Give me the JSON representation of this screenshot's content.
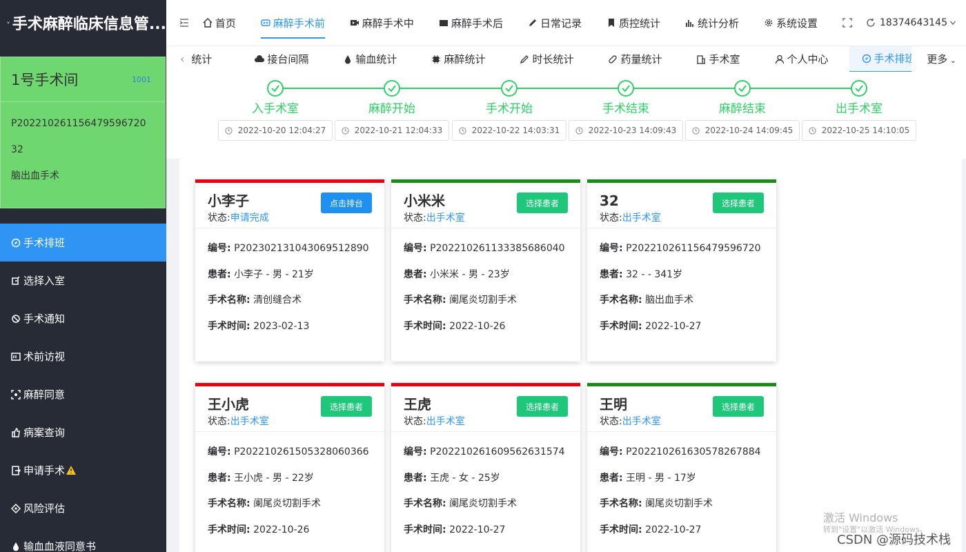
{
  "app": {
    "title": "手术麻醉临床信息管..."
  },
  "room": {
    "name": "1号手术间",
    "code": "1001",
    "patient_id": "P202210261156479596720",
    "patient_name": "32",
    "operation": "脑出血手术"
  },
  "sidebar": {
    "items": [
      {
        "label": "手术排班",
        "icon": "compass-icon"
      },
      {
        "label": "选择入室",
        "icon": "door-icon"
      },
      {
        "label": "手术通知",
        "icon": "bell-off-icon"
      },
      {
        "label": "术前访视",
        "icon": "id-card-icon"
      },
      {
        "label": "麻醉同意",
        "icon": "scan-icon"
      },
      {
        "label": "病案查询",
        "icon": "thumb-icon"
      },
      {
        "label": "申请手术",
        "icon": "export-icon"
      },
      {
        "label": "风险评估",
        "icon": "diamond-icon"
      },
      {
        "label": "输血血液同意书",
        "icon": "drop-icon"
      }
    ]
  },
  "top_nav": {
    "items": [
      {
        "label": "首页",
        "icon": "home-icon"
      },
      {
        "label": "麻醉手术前",
        "icon": "pre-op-icon"
      },
      {
        "label": "麻醉手术中",
        "icon": "video-icon"
      },
      {
        "label": "麻醉手术后",
        "icon": "camera-icon"
      },
      {
        "label": "日常记录",
        "icon": "pen-icon"
      },
      {
        "label": "质控统计",
        "icon": "bookmark-icon"
      },
      {
        "label": "统计分析",
        "icon": "bars-icon"
      },
      {
        "label": "系统设置",
        "icon": "gear-icon"
      }
    ],
    "user": "18374643145"
  },
  "tabs": {
    "items": [
      {
        "label": "统计",
        "icon": ""
      },
      {
        "label": "接台间隔",
        "icon": "cloud-icon"
      },
      {
        "label": "输血统计",
        "icon": "drop-icon"
      },
      {
        "label": "麻醉统计",
        "icon": "chip-icon"
      },
      {
        "label": "时长统计",
        "icon": "pen-icon"
      },
      {
        "label": "药量统计",
        "icon": "pill-icon"
      },
      {
        "label": "手术室",
        "icon": "building-icon"
      },
      {
        "label": "个人中心",
        "icon": "user-icon"
      },
      {
        "label": "手术排班",
        "icon": "compass-icon"
      }
    ],
    "more": "更多"
  },
  "steps": [
    {
      "label": "入手术室",
      "time": "2022-10-20 12:04:27"
    },
    {
      "label": "麻醉开始",
      "time": "2022-10-21 12:04:33"
    },
    {
      "label": "手术开始",
      "time": "2022-10-22 14:03:31"
    },
    {
      "label": "手术结束",
      "time": "2022-10-23 14:09:43"
    },
    {
      "label": "麻醉结束",
      "time": "2022-10-24 14:09:45"
    },
    {
      "label": "出手术室",
      "time": "2022-10-25 14:10:05"
    }
  ],
  "card_labels": {
    "status": "状态:",
    "id": "编号:",
    "patient": "患者:",
    "op": "手术名称:",
    "time": "手术时间:"
  },
  "cards": [
    {
      "name": "小李子",
      "status": "申请完成",
      "button": "点击排台",
      "btn_color": "#1e90f0",
      "bar_color": "#e60012",
      "id": "P20230213104306951289​0",
      "patient": "小李子 - 男 - 21岁",
      "op": "清创缝合术",
      "time": "2023-02-13"
    },
    {
      "name": "小米米",
      "status": "出手术室",
      "button": "选择患者",
      "btn_color": "#1ec77a",
      "bar_color": "#1a8a1a",
      "id": "P202210261133385686040",
      "patient": "小米米 - 男 - 23岁",
      "op": "阑尾炎切割手术",
      "time": "2022-10-26"
    },
    {
      "name": "32",
      "status": "出手术室",
      "button": "选择患者",
      "btn_color": "#1ec77a",
      "bar_color": "#1a8a1a",
      "id": "P202210261156479596720",
      "patient": "32 - - 341岁",
      "op": "脑出血手术",
      "time": "2022-10-27"
    },
    {
      "name": "王小虎",
      "status": "出手术室",
      "button": "选择患者",
      "btn_color": "#1ec77a",
      "bar_color": "#e60012",
      "id": "P202210261505328060366",
      "patient": "王小虎 - 男 - 22岁",
      "op": "阑尾炎切割手术",
      "time": "2022-10-26"
    },
    {
      "name": "王虎",
      "status": "出手术室",
      "button": "选择患者",
      "btn_color": "#1ec77a",
      "bar_color": "#e60012",
      "id": "P202210261609562631574",
      "patient": "王虎 - 女 - 25岁",
      "op": "阑尾炎切割手术",
      "time": "2022-10-27"
    },
    {
      "name": "王明",
      "status": "出手术室",
      "button": "选择患者",
      "btn_color": "#1ec77a",
      "bar_color": "#1a8a1a",
      "id": "P202210261630578267884",
      "patient": "王明 - 男 - 17岁",
      "op": "阑尾炎切割手术",
      "time": "2022-10-27"
    }
  ],
  "watermark": {
    "line1": "激活 Windows",
    "line2": "转到\"设置\"以激活 Windows。",
    "csdn": "CSDN @源码技术栈"
  }
}
